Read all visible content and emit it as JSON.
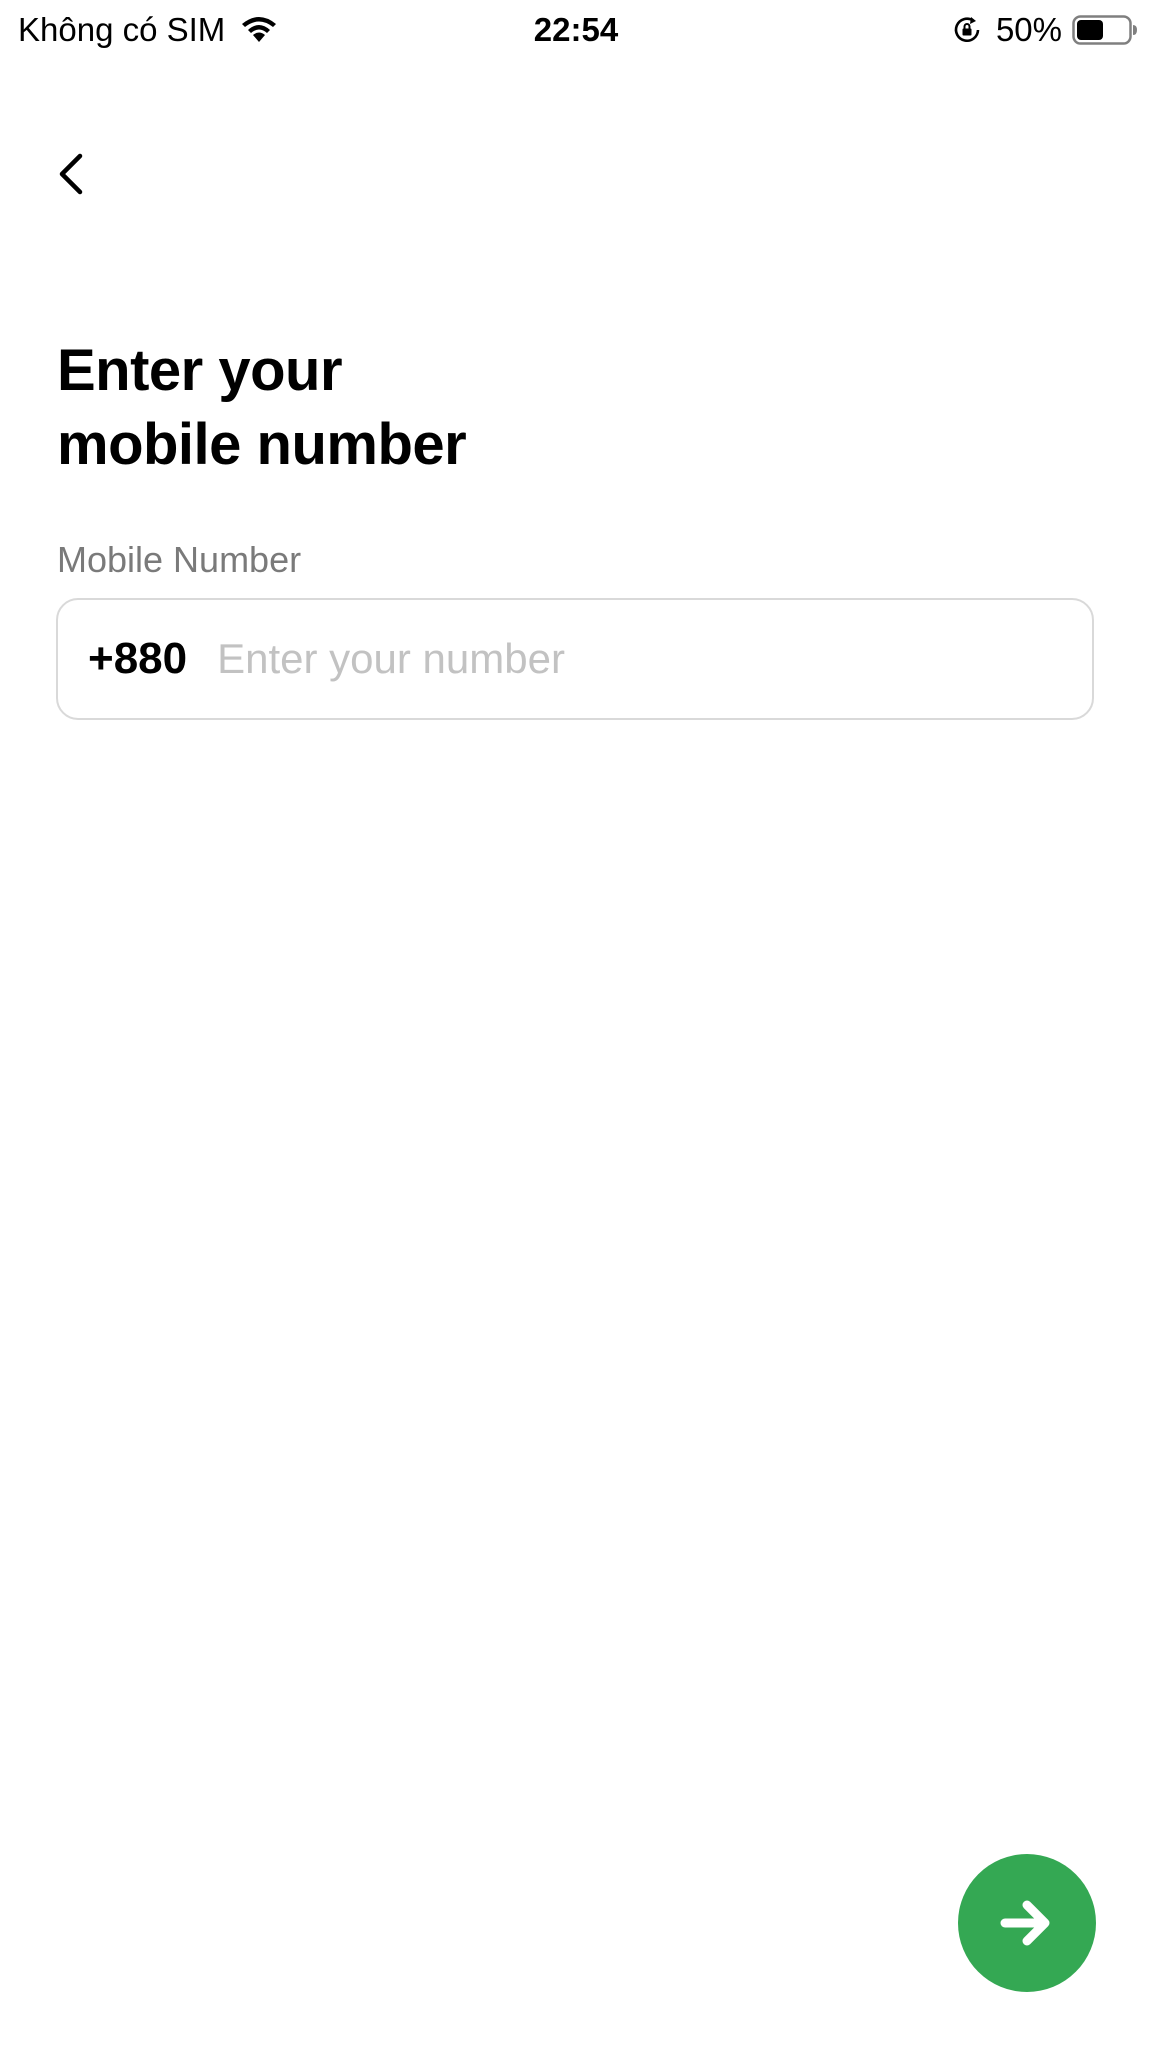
{
  "status_bar": {
    "carrier": "Không có SIM",
    "time": "22:54",
    "battery": "50%"
  },
  "header": {
    "back_icon": "chevron-left-icon"
  },
  "title": {
    "line1": "Enter your",
    "line2": "mobile number"
  },
  "form": {
    "field_label": "Mobile Number",
    "country_code": "+880",
    "phone_value": "",
    "phone_placeholder": "Enter your number"
  },
  "next_button": {
    "icon": "arrow-right-icon",
    "color": "#34a853"
  },
  "colors": {
    "accent": "#34a853",
    "label": "#7a7a7a",
    "placeholder": "#c2c2c2",
    "border": "#d9d9d9"
  }
}
